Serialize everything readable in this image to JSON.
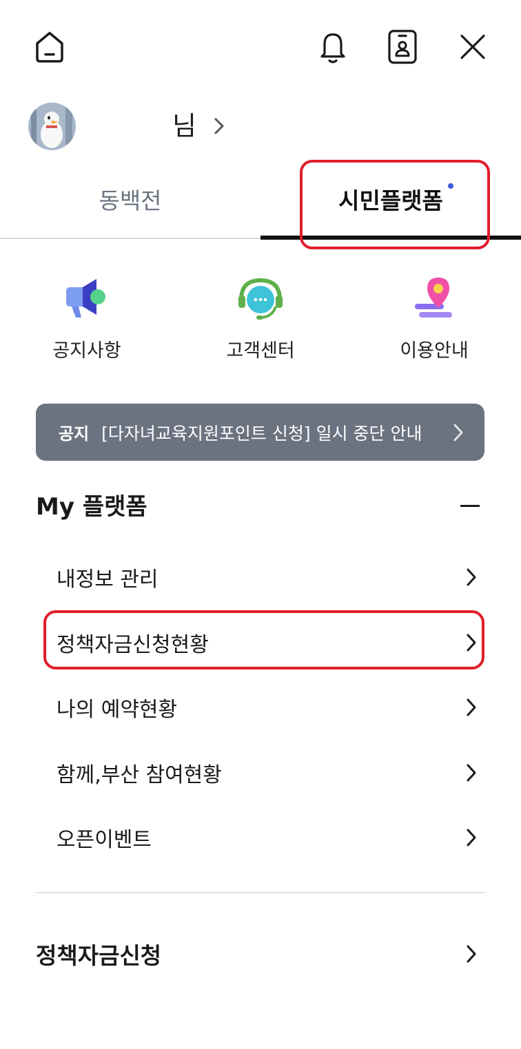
{
  "header": {
    "home_icon": "home-icon",
    "bell_icon": "bell-icon",
    "id_card_icon": "id-card-icon",
    "close_icon": "close-icon"
  },
  "profile": {
    "name_suffix": "님"
  },
  "tabs": [
    {
      "label": "동백전",
      "active": false
    },
    {
      "label": "시민플랫폼",
      "active": true
    }
  ],
  "quick_menu": [
    {
      "label": "공지사항",
      "icon": "megaphone-icon"
    },
    {
      "label": "고객센터",
      "icon": "headset-chat-icon"
    },
    {
      "label": "이용안내",
      "icon": "map-pin-icon"
    }
  ],
  "notice": {
    "tag": "공지",
    "text": "[다자녀교육지원포인트 신청] 일시 중단 안내"
  },
  "my_platform": {
    "title": "My 플랫폼",
    "items": [
      {
        "label": "내정보 관리"
      },
      {
        "label": "정책자금신청현황"
      },
      {
        "label": "나의 예약현황"
      },
      {
        "label": "함께,부산 참여현황"
      },
      {
        "label": "오픈이벤트"
      }
    ]
  },
  "policy_fund": {
    "label": "정책자금신청"
  },
  "colors": {
    "highlight": "#e11d2a",
    "notice_bg": "#6b7280",
    "tab_dot": "#3d5bd9"
  }
}
